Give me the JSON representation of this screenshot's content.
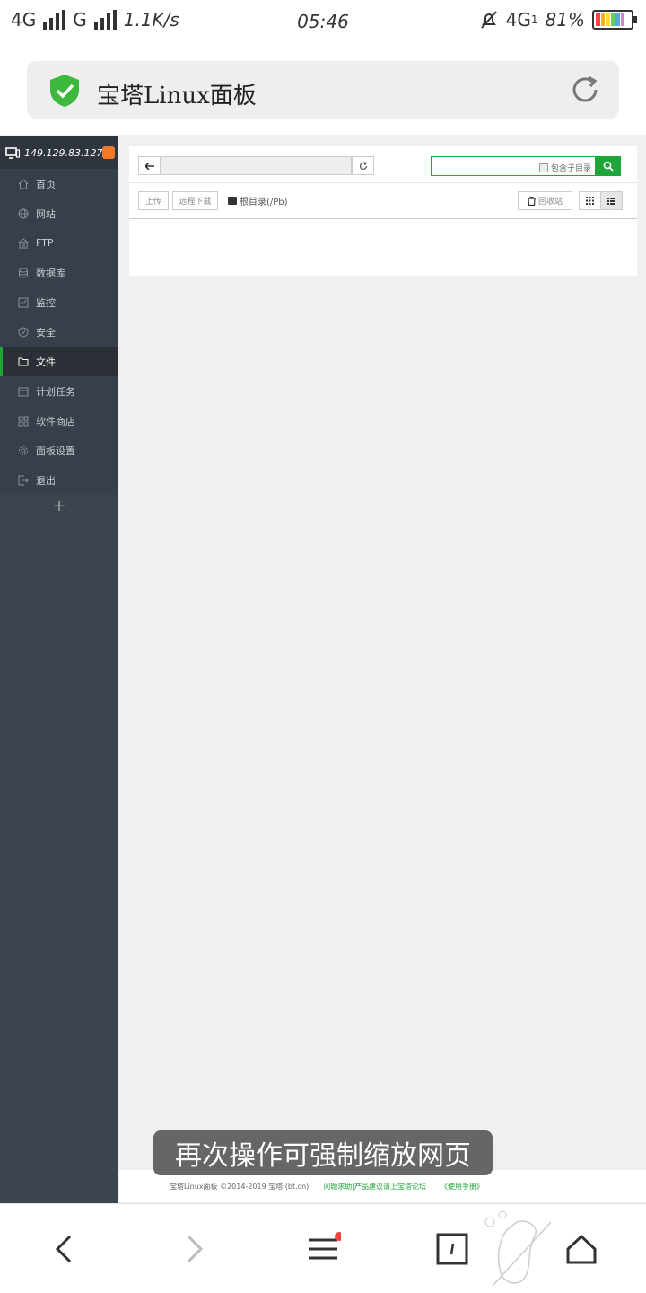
{
  "status_bar": {
    "net1": "4G",
    "net2": "G",
    "speed": "1.1K/s",
    "time": "05:46",
    "net3": "4G",
    "sim_index": "1",
    "battery": "81%"
  },
  "browser": {
    "page_title": "宝塔Linux面板"
  },
  "sidebar": {
    "host": "149.129.83.127",
    "items": [
      {
        "label": "首页",
        "icon": "home-icon"
      },
      {
        "label": "网站",
        "icon": "globe-icon"
      },
      {
        "label": "FTP",
        "icon": "ftp-icon"
      },
      {
        "label": "数据库",
        "icon": "database-icon"
      },
      {
        "label": "监控",
        "icon": "monitor-icon"
      },
      {
        "label": "安全",
        "icon": "shield-icon"
      },
      {
        "label": "文件",
        "icon": "folder-icon"
      },
      {
        "label": "计划任务",
        "icon": "calendar-icon"
      },
      {
        "label": "软件商店",
        "icon": "grid-icon"
      },
      {
        "label": "面板设置",
        "icon": "gear-icon"
      },
      {
        "label": "退出",
        "icon": "logout-icon"
      }
    ],
    "active_index": 6,
    "add_label": "+"
  },
  "files": {
    "include_subdir_label": "包含子目录",
    "upload_label": "上传",
    "remote_download_label": "远程下载",
    "root_dir_label": "根目录(/Pb)",
    "recycle_bin_label": "回收站"
  },
  "footer": {
    "copyright": "宝塔Linux面板 ©2014-2019 宝塔 (bt.cn)",
    "feedback": "问题求助|产品建议请上宝塔论坛",
    "manual": "《使用手册》"
  },
  "toast": {
    "text": "再次操作可强制缩放网页"
  },
  "colors": {
    "accent": "#20a53a",
    "sidebar_bg": "#3c444d",
    "badge": "#f57a28"
  }
}
